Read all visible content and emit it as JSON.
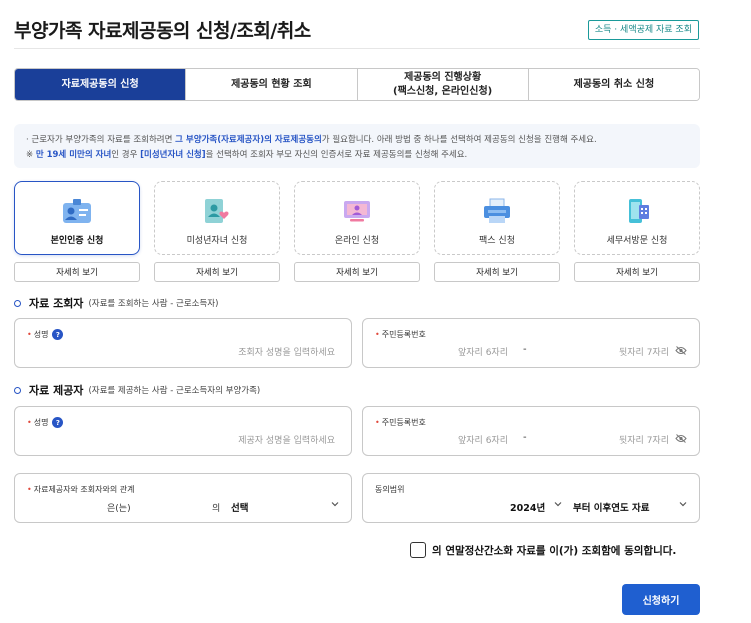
{
  "page": {
    "title": "부양가족 자료제공동의 신청/조회/취소",
    "title_link": "소득 · 세액공제 자료 조회"
  },
  "tabs": [
    {
      "label": "자료제공동의 신청",
      "active": true
    },
    {
      "label": "제공동의 현황 조회",
      "active": false
    },
    {
      "label": "제공동의 진행상황\n(팩스신청, 온라인신청)",
      "active": false
    },
    {
      "label": "제공동의 취소 신청",
      "active": false
    }
  ],
  "notice": {
    "line1_a": "· 근로자가 부양가족의 자료를 조회하려면 ",
    "line1_hl": "그 부양가족(자료제공자)의 자료제공동의",
    "line1_b": "가 필요합니다. 아래 방법 중 하나를 선택하여 제공동의 신청을 진행해 주세요.",
    "line2_a": "※ ",
    "line2_hl1": "만 19세 미만의 자녀",
    "line2_b": "인 경우 ",
    "line2_hl2": "[미성년자녀 신청]",
    "line2_c": "을 선택하여 조회자 부모 자신의 인증서로 자료 제공동의를 신청해 주세요."
  },
  "methods": [
    {
      "label": "본인인증 신청",
      "icon": "id-card-icon",
      "detail": "자세히 보기",
      "active": true
    },
    {
      "label": "미성년자녀 신청",
      "icon": "child-doc-icon",
      "detail": "자세히 보기",
      "active": false
    },
    {
      "label": "온라인 신청",
      "icon": "monitor-icon",
      "detail": "자세히 보기",
      "active": false
    },
    {
      "label": "팩스 신청",
      "icon": "fax-icon",
      "detail": "자세히 보기",
      "active": false
    },
    {
      "label": "세무서방문 신청",
      "icon": "phone-icon",
      "detail": "자세히 보기",
      "active": false
    }
  ],
  "viewer": {
    "title": "자료 조회자",
    "subtitle": "(자료를 조회하는 사람 - 근로소득자)",
    "name_label": "성명",
    "name_placeholder": "조회자 성명을 입력하세요",
    "rrn_label": "주민등록번호",
    "rrn_front": "앞자리 6자리",
    "rrn_dash": "-",
    "rrn_back": "뒷자리 7자리"
  },
  "provider": {
    "title": "자료 제공자",
    "subtitle": "(자료를 제공하는 사람 - 근로소득자의 부양가족)",
    "name_label": "성명",
    "name_placeholder": "제공자 성명을 입력하세요",
    "rrn_label": "주민등록번호",
    "rrn_front": "앞자리 6자리",
    "rrn_dash": "-",
    "rrn_back": "뒷자리 7자리"
  },
  "relation": {
    "label": "자료제공자와 조회자와의 관계",
    "text1": "은(는)",
    "text2": "의",
    "select": "선택"
  },
  "scope": {
    "label": "동의범위",
    "year": "2024년",
    "range": "부터 이후연도 자료"
  },
  "agreement": "의 연말정산간소화 자료를 이(가) 조회함에 동의합니다.",
  "submit": "신청하기",
  "colors": {
    "primary": "#1a3f99",
    "accent": "#2855c5",
    "button": "#1f5fd0",
    "required": "#e0483b"
  }
}
